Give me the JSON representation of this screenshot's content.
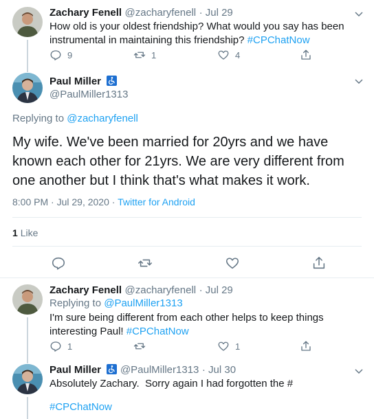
{
  "tweet1": {
    "name": "Zachary Fenell",
    "handle": "@zacharyfenell",
    "date": "· Jul 29",
    "text": "How old is your oldest friendship? What would you say has been instrumental in maintaining this friendship?",
    "hashtag": "#CPChatNow",
    "replies": "9",
    "retweets": "1",
    "likes": "4"
  },
  "main": {
    "name": "Paul Miller",
    "handle": "@PaulMiller1313",
    "replying_prefix": "Replying to",
    "replying_to": "@zacharyfenell",
    "text": "My wife. We've been married for 20yrs and we have known each other for 21yrs. We are very different from one another but I think that's what makes it work.",
    "time": "8:00 PM · Jul 29, 2020 ·",
    "source": "Twitter for Android",
    "likes_count": "1",
    "likes_label": "Like"
  },
  "tweet3": {
    "name": "Zachary Fenell",
    "handle": "@zacharyfenell",
    "date": "· Jul 29",
    "replying_prefix": "Replying to",
    "replying_to": "@PaulMiller1313",
    "text": "I'm sure being different from each other helps to keep things interesting Paul!",
    "hashtag": "#CPChatNow",
    "replies": "1",
    "likes": "1"
  },
  "tweet4": {
    "name": "Paul Miller",
    "handle": "@PaulMiller1313",
    "date": "· Jul 30",
    "text": "Absolutely Zachary.  Sorry again I had forgotten the #",
    "hashtag": "#CPChatNow"
  },
  "colors": {
    "accent": "#1da1f2",
    "muted": "#657786",
    "divider": "#e6ecf0",
    "badge": "#1d6fd1"
  }
}
